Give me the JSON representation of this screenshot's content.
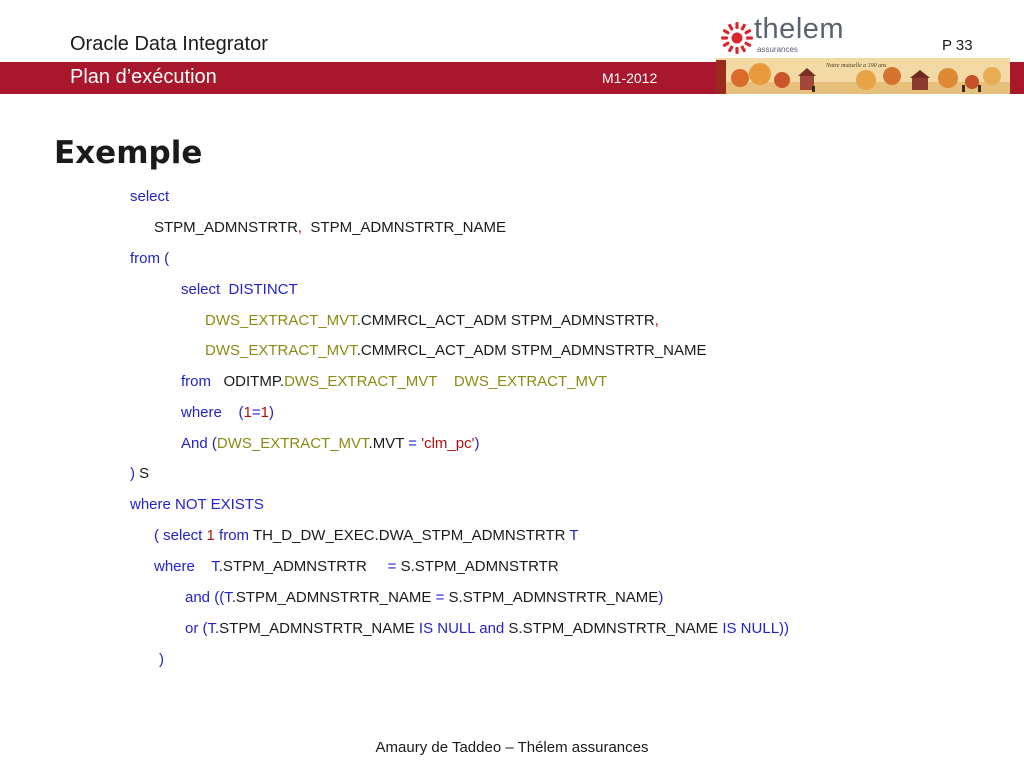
{
  "header": {
    "title": "Oracle Data Integrator",
    "page": "P 33",
    "logo_name": "thelem",
    "logo_sub": "assurances",
    "banner_caption": "Notre mutuelle a 190 ans",
    "band_title": "Plan d’exécution",
    "date": "M1-2012"
  },
  "colors": {
    "band": "#a8172c",
    "keyword": "#2323c8",
    "object": "#8b8b14",
    "literal": "#b01212",
    "logo": "#d8262e"
  },
  "section_title": "Exemple",
  "code": [
    [
      {
        "t": "select",
        "c": "kw"
      }
    ],
    [
      {
        "t": "STPM_ADMNSTRTR",
        "c": "tx"
      },
      {
        "t": ",",
        "c": "lit"
      },
      {
        "t": "  STPM_ADMNSTRTR_NAME",
        "c": "tx"
      }
    ],
    [
      {
        "t": "from (",
        "c": "kw"
      }
    ],
    [
      {
        "t": "select  DISTINCT",
        "c": "kw"
      }
    ],
    [
      {
        "t": "DWS_EXTRACT_MVT",
        "c": "obj"
      },
      {
        "t": ".CMMRCL_ACT_ADM STPM_ADMNSTRTR",
        "c": "tx"
      },
      {
        "t": ",",
        "c": "lit"
      }
    ],
    [
      {
        "t": "DWS_EXTRACT_MVT",
        "c": "obj"
      },
      {
        "t": ".CMMRCL_ACT_ADM STPM_ADMNSTRTR_NAME",
        "c": "tx"
      }
    ],
    [
      {
        "t": "from",
        "c": "kw"
      },
      {
        "t": "   ODITMP.",
        "c": "tx"
      },
      {
        "t": "DWS_EXTRACT_MVT    DWS_EXTRACT_MVT",
        "c": "obj"
      }
    ],
    [
      {
        "t": "where    (",
        "c": "kw"
      },
      {
        "t": "1",
        "c": "lit"
      },
      {
        "t": "=",
        "c": "kw"
      },
      {
        "t": "1",
        "c": "lit"
      },
      {
        "t": ")",
        "c": "kw"
      }
    ],
    [
      {
        "t": "And (",
        "c": "kw"
      },
      {
        "t": "DWS_EXTRACT_MVT",
        "c": "obj"
      },
      {
        "t": ".MVT ",
        "c": "tx"
      },
      {
        "t": "= ",
        "c": "kw"
      },
      {
        "t": "'clm_pc'",
        "c": "lit"
      },
      {
        "t": ")",
        "c": "kw"
      }
    ],
    [
      {
        "t": ")",
        "c": "kw"
      },
      {
        "t": " S",
        "c": "tx"
      }
    ],
    [
      {
        "t": "where NOT EXISTS",
        "c": "kw"
      }
    ],
    [
      {
        "t": "( select ",
        "c": "kw"
      },
      {
        "t": "1",
        "c": "lit"
      },
      {
        "t": " from ",
        "c": "kw"
      },
      {
        "t": "TH_D_DW_EXEC.DWA_STPM_ADMNSTRTR ",
        "c": "tx"
      },
      {
        "t": "T",
        "c": "kw"
      }
    ],
    [
      {
        "t": "where    T",
        "c": "kw"
      },
      {
        "t": ".STPM_ADMNSTRTR     ",
        "c": "tx"
      },
      {
        "t": "= ",
        "c": "kw"
      },
      {
        "t": "S.STPM_ADMNSTRTR",
        "c": "tx"
      }
    ],
    [
      {
        "t": "and ((T",
        "c": "kw"
      },
      {
        "t": ".STPM_ADMNSTRTR_NAME ",
        "c": "tx"
      },
      {
        "t": "= ",
        "c": "kw"
      },
      {
        "t": "S.STPM_ADMNSTRTR_NAME",
        "c": "tx"
      },
      {
        "t": ")",
        "c": "kw"
      }
    ],
    [
      {
        "t": "or (T",
        "c": "kw"
      },
      {
        "t": ".STPM_ADMNSTRTR_NAME ",
        "c": "tx"
      },
      {
        "t": "IS NULL and ",
        "c": "kw"
      },
      {
        "t": "S.STPM_ADMNSTRTR_NAME ",
        "c": "tx"
      },
      {
        "t": "IS NULL))",
        "c": "kw"
      }
    ],
    [
      {
        "t": ")",
        "c": "kw"
      }
    ]
  ],
  "footer": "Amaury de Taddeo – Thélem assurances"
}
